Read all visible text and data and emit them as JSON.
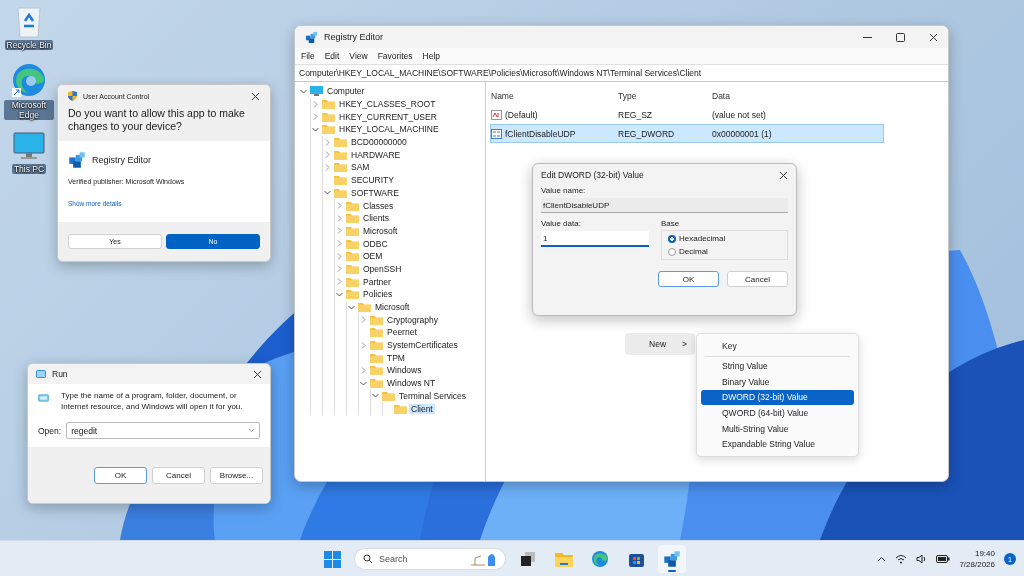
{
  "desktop_icons": [
    {
      "label": "Recycle Bin",
      "kind": "recycle"
    },
    {
      "label": "Microsoft Edge",
      "kind": "edge"
    },
    {
      "label": "This PC",
      "kind": "pc"
    }
  ],
  "uac": {
    "title": "User Account Control",
    "question": "Do you want to allow this app to make changes to your device?",
    "app_name": "Registry Editor",
    "publisher": "Verified publisher: Microsoft Windows",
    "details_link": "Show more details",
    "buttons": [
      {
        "label": "Yes",
        "default": false
      },
      {
        "label": "No",
        "default": true
      }
    ]
  },
  "run": {
    "title": "Run",
    "description": "Type the name of a program, folder, document, or Internet resource, and Windows will open it for you.",
    "open_label": "Open:",
    "value": "regedit",
    "buttons": [
      {
        "label": "OK",
        "default": true
      },
      {
        "label": "Cancel",
        "default": false
      },
      {
        "label": "Browse...",
        "default": false
      }
    ]
  },
  "registry": {
    "title": "Registry Editor",
    "menu": [
      "File",
      "Edit",
      "View",
      "Favorites",
      "Help"
    ],
    "address": "Computer\\HKEY_LOCAL_MACHINE\\SOFTWARE\\Policies\\Microsoft\\Windows NT\\Terminal Services\\Client",
    "tree": [
      {
        "label": "Computer",
        "kind": "branch",
        "expanded": true,
        "selected": false,
        "children": [
          {
            "label": "HKEY_CLASSES_ROOT",
            "kind": "branch",
            "expanded": false,
            "selected": false
          },
          {
            "label": "HKEY_CURRENT_USER",
            "kind": "branch",
            "expanded": false,
            "selected": false
          },
          {
            "label": "HKEY_LOCAL_MACHINE",
            "kind": "branch",
            "expanded": true,
            "selected": false,
            "children": [
              {
                "label": "BCD00000000",
                "kind": "branch",
                "expanded": false,
                "selected": false
              },
              {
                "label": "HARDWARE",
                "kind": "branch",
                "expanded": false,
                "selected": false
              },
              {
                "label": "SAM",
                "kind": "branch",
                "expanded": false,
                "selected": false
              },
              {
                "label": "SECURITY",
                "kind": "leaf",
                "selected": false
              },
              {
                "label": "SOFTWARE",
                "kind": "branch",
                "expanded": true,
                "selected": false,
                "children": [
                  {
                    "label": "Classes",
                    "kind": "branch",
                    "expanded": false,
                    "selected": false
                  },
                  {
                    "label": "Clients",
                    "kind": "branch",
                    "expanded": false,
                    "selected": false
                  },
                  {
                    "label": "Microsoft",
                    "kind": "branch",
                    "expanded": false,
                    "selected": false
                  },
                  {
                    "label": "ODBC",
                    "kind": "branch",
                    "expanded": false,
                    "selected": false
                  },
                  {
                    "label": "OEM",
                    "kind": "branch",
                    "expanded": false,
                    "selected": false
                  },
                  {
                    "label": "OpenSSH",
                    "kind": "branch",
                    "expanded": false,
                    "selected": false
                  },
                  {
                    "label": "Partner",
                    "kind": "branch",
                    "expanded": false,
                    "selected": false
                  },
                  {
                    "label": "Policies",
                    "kind": "branch",
                    "expanded": true,
                    "selected": false,
                    "children": [
                      {
                        "label": "Microsoft",
                        "kind": "branch",
                        "expanded": true,
                        "selected": false,
                        "children": [
                          {
                            "label": "Cryptography",
                            "kind": "branch",
                            "expanded": false,
                            "selected": false
                          },
                          {
                            "label": "Peernet",
                            "kind": "leaf",
                            "selected": false
                          },
                          {
                            "label": "SystemCertificates",
                            "kind": "branch",
                            "expanded": false,
                            "selected": false
                          },
                          {
                            "label": "TPM",
                            "kind": "leaf",
                            "selected": false
                          },
                          {
                            "label": "Windows",
                            "kind": "branch",
                            "expanded": false,
                            "selected": false
                          },
                          {
                            "label": "Windows NT",
                            "kind": "branch",
                            "expanded": true,
                            "selected": false,
                            "children": [
                              {
                                "label": "Terminal Services",
                                "kind": "branch",
                                "expanded": true,
                                "selected": false,
                                "children": [
                                  {
                                    "label": "Client",
                                    "kind": "leaf",
                                    "selected": true
                                  }
                                ]
                              }
                            ]
                          }
                        ]
                      }
                    ]
                  }
                ]
              }
            ]
          }
        ]
      }
    ],
    "columns": [
      "Name",
      "Type",
      "Data"
    ],
    "values": [
      {
        "name": "(Default)",
        "type": "REG_SZ",
        "data": "(value not set)",
        "kind": "string",
        "selected": false
      },
      {
        "name": "fClientDisableUDP",
        "type": "REG_DWORD",
        "data": "0x00000001 (1)",
        "kind": "binary",
        "selected": true
      }
    ]
  },
  "edit_dialog": {
    "title": "Edit DWORD (32-bit) Value",
    "name_label": "Value name:",
    "name_value": "fClientDisableUDP",
    "data_label": "Value data:",
    "data_value": "1",
    "base_label": "Base",
    "bases": [
      {
        "label": "Hexadecimal",
        "selected": true
      },
      {
        "label": "Decimal",
        "selected": false
      }
    ],
    "buttons": [
      {
        "label": "OK",
        "default": true
      },
      {
        "label": "Cancel",
        "default": false
      }
    ]
  },
  "context_menu": {
    "item": "New",
    "arrow": ">",
    "submenu": [
      {
        "label": "Key",
        "selected": false,
        "separator_after": true
      },
      {
        "label": "String Value",
        "selected": false,
        "separator_after": false
      },
      {
        "label": "Binary Value",
        "selected": false,
        "separator_after": false
      },
      {
        "label": "DWORD (32-bit) Value",
        "selected": true,
        "separator_after": false
      },
      {
        "label": "QWORD (64-bit) Value",
        "selected": false,
        "separator_after": false
      },
      {
        "label": "Multi-String Value",
        "selected": false,
        "separator_after": false
      },
      {
        "label": "Expandable String Value",
        "selected": false,
        "separator_after": false
      }
    ]
  },
  "taskbar": {
    "search_placeholder": "Search",
    "apps": [
      {
        "kind": "taskview",
        "active": false
      },
      {
        "kind": "explorer",
        "active": false
      },
      {
        "kind": "edge",
        "active": false
      },
      {
        "kind": "store",
        "active": false
      },
      {
        "kind": "regedit",
        "active": true
      }
    ],
    "time": "19:40",
    "date": "7/28/2026",
    "notifications": "1"
  }
}
